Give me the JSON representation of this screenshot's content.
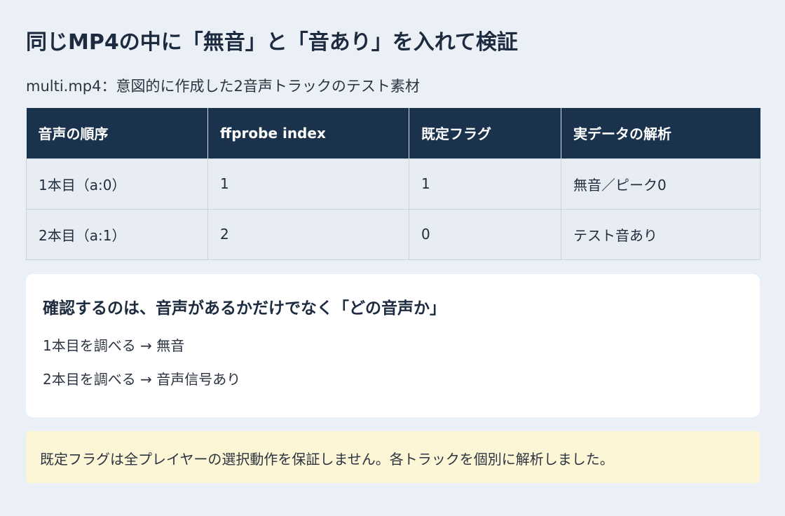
{
  "title": "同じMP4の中に「無音」と「音あり」を入れて検証",
  "subtitle": "multi.mp4：意図的に作成した2音声トラックのテスト素材",
  "table": {
    "headers": [
      "音声の順序",
      "ffprobe index",
      "既定フラグ",
      "実データの解析"
    ],
    "rows": [
      [
        "1本目（a:0）",
        "1",
        "1",
        "無音／ピーク0"
      ],
      [
        "2本目（a:1）",
        "2",
        "0",
        "テスト音あり"
      ]
    ]
  },
  "card": {
    "title": "確認するのは、音声があるかだけでなく「どの音声か」",
    "lines": [
      "1本目を調べる → 無音",
      "2本目を調べる → 音声信号あり"
    ]
  },
  "note": "既定フラグは全プレイヤーの選択動作を保証しません。各トラックを個別に解析しました。",
  "colors": {
    "background": "#ebf0f6",
    "header_bg": "#1b324d",
    "note_bg": "#fdf6d6"
  }
}
